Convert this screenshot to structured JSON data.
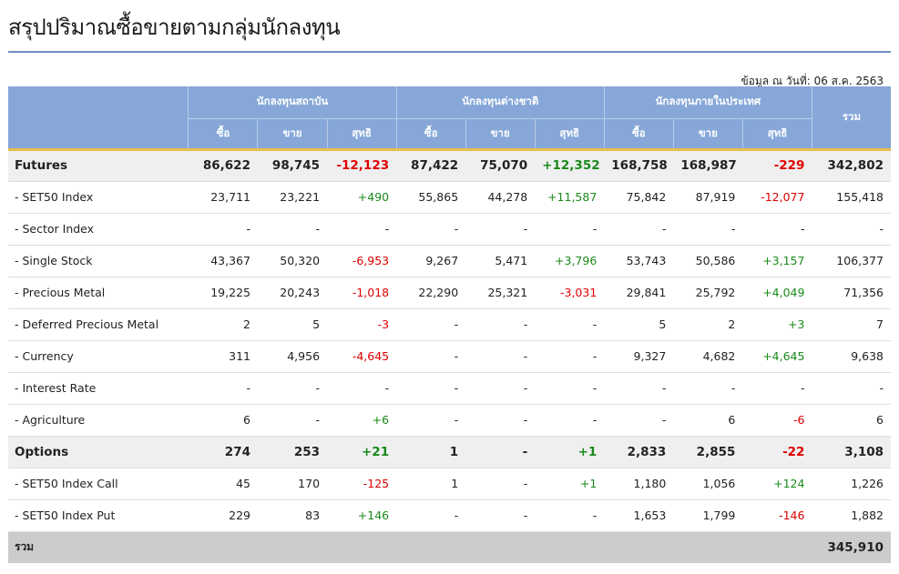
{
  "page": {
    "title": "สรุปปริมาณซื้อขายตามกลุ่มนักลงทุน",
    "as_of": "ข้อมูล ณ วันที่: 06 ส.ค. 2563"
  },
  "colors": {
    "header_bg": "#86a7d8",
    "header_rule": "#e5c04a",
    "negative": "#e00000",
    "positive": "#1a8a1a",
    "group_row_bg": "#efefef",
    "total_row_bg": "#cccccc"
  },
  "table": {
    "groups": [
      {
        "label": "นักลงทุนสถาบัน"
      },
      {
        "label": "นักลงทุนต่างชาติ"
      },
      {
        "label": "นักลงทุนภายในประเทศ"
      }
    ],
    "total_header": "รวม",
    "sub_headers": [
      "ซื้อ",
      "ขาย",
      "สุทธิ"
    ],
    "rows": [
      {
        "kind": "group",
        "label": "Futures",
        "cells": [
          "86,622",
          "98,745",
          "-12,123",
          "87,422",
          "75,070",
          "+12,352",
          "168,758",
          "168,987",
          "-229"
        ],
        "total": "342,802"
      },
      {
        "kind": "item",
        "label": "- SET50 Index",
        "cells": [
          "23,711",
          "23,221",
          "+490",
          "55,865",
          "44,278",
          "+11,587",
          "75,842",
          "87,919",
          "-12,077"
        ],
        "total": "155,418"
      },
      {
        "kind": "item",
        "label": "- Sector Index",
        "cells": [
          "-",
          "-",
          "-",
          "-",
          "-",
          "-",
          "-",
          "-",
          "-"
        ],
        "total": "-"
      },
      {
        "kind": "item",
        "label": "- Single Stock",
        "cells": [
          "43,367",
          "50,320",
          "-6,953",
          "9,267",
          "5,471",
          "+3,796",
          "53,743",
          "50,586",
          "+3,157"
        ],
        "total": "106,377"
      },
      {
        "kind": "item",
        "label": "- Precious Metal",
        "cells": [
          "19,225",
          "20,243",
          "-1,018",
          "22,290",
          "25,321",
          "-3,031",
          "29,841",
          "25,792",
          "+4,049"
        ],
        "total": "71,356"
      },
      {
        "kind": "item",
        "label": "- Deferred Precious Metal",
        "cells": [
          "2",
          "5",
          "-3",
          "-",
          "-",
          "-",
          "5",
          "2",
          "+3"
        ],
        "total": "7"
      },
      {
        "kind": "item",
        "label": "- Currency",
        "cells": [
          "311",
          "4,956",
          "-4,645",
          "-",
          "-",
          "-",
          "9,327",
          "4,682",
          "+4,645"
        ],
        "total": "9,638"
      },
      {
        "kind": "item",
        "label": "- Interest Rate",
        "cells": [
          "-",
          "-",
          "-",
          "-",
          "-",
          "-",
          "-",
          "-",
          "-"
        ],
        "total": "-"
      },
      {
        "kind": "item",
        "label": "- Agriculture",
        "cells": [
          "6",
          "-",
          "+6",
          "-",
          "-",
          "-",
          "-",
          "6",
          "-6"
        ],
        "total": "6"
      },
      {
        "kind": "group",
        "label": "Options",
        "cells": [
          "274",
          "253",
          "+21",
          "1",
          "-",
          "+1",
          "2,833",
          "2,855",
          "-22"
        ],
        "total": "3,108"
      },
      {
        "kind": "item",
        "label": "- SET50 Index Call",
        "cells": [
          "45",
          "170",
          "-125",
          "1",
          "-",
          "+1",
          "1,180",
          "1,056",
          "+124"
        ],
        "total": "1,226"
      },
      {
        "kind": "item",
        "label": "- SET50 Index Put",
        "cells": [
          "229",
          "83",
          "+146",
          "-",
          "-",
          "-",
          "1,653",
          "1,799",
          "-146"
        ],
        "total": "1,882"
      }
    ],
    "grand_total": {
      "label": "รวม",
      "total": "345,910"
    }
  }
}
